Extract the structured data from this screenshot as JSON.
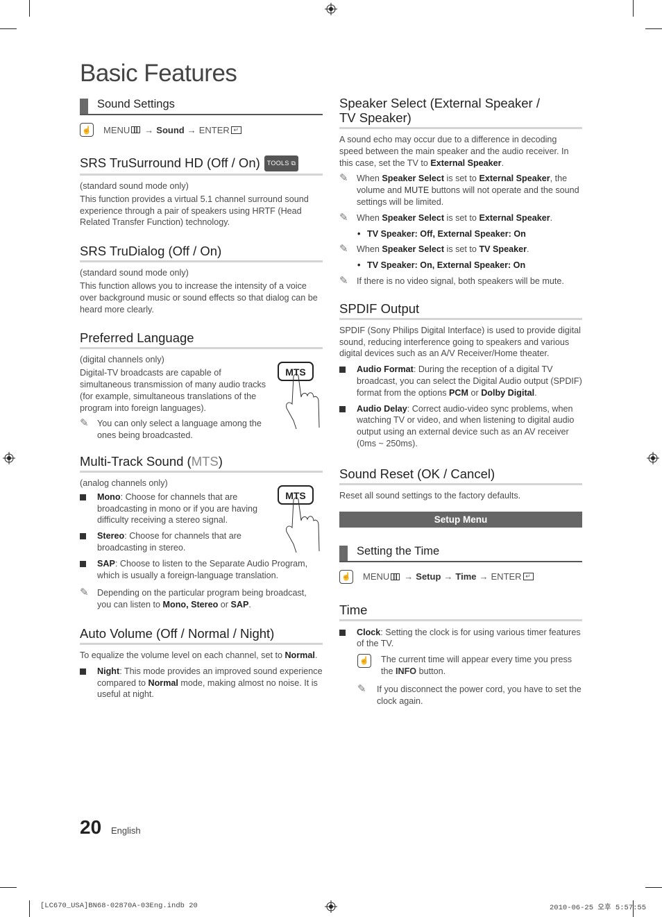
{
  "page": {
    "title": "Basic Features",
    "page_number": "20",
    "language": "English"
  },
  "slug": {
    "file": "[LC670_USA]BN68-02870A-03Eng.indb   20",
    "datetime": "2010-06-25   오후 5:57:55"
  },
  "left": {
    "sound_settings": {
      "header": "Sound Settings",
      "menu_path": {
        "menu": "MENU",
        "arrow": "→",
        "step1": "Sound",
        "enter": "ENTER"
      }
    },
    "srs_trusurround": {
      "title": "SRS TruSurround HD (Off / On)",
      "tools_badge": "TOOLS",
      "mode": "(standard sound mode only)",
      "body": "This function provides a virtual 5.1 channel surround sound experience through a pair of speakers using HRTF (Head Related Transfer Function) technology."
    },
    "srs_trudialog": {
      "title": "SRS TruDialog (Off / On)",
      "mode": "(standard sound mode only)",
      "body": "This function allows you to increase the intensity of a voice over background music or sound effects so that dialog can be heard more clearly."
    },
    "preferred_language": {
      "title": "Preferred Language",
      "mode": "(digital channels only)",
      "body": "Digital-TV broadcasts are capable of simultaneous transmission of many audio tracks (for example, simultaneous translations of the program into foreign languages).",
      "note": "You can only select a language among the ones being broadcasted.",
      "button_label": "MTS"
    },
    "multi_track": {
      "title_prefix": "Multi-Track Sound (",
      "title_mts": "MTS",
      "title_suffix": ")",
      "mode": "(analog channels only)",
      "button_label": "MTS",
      "items": [
        {
          "term": "Mono",
          "text": ": Choose for channels that are broadcasting in mono or if you are having difficulty receiving a stereo signal."
        },
        {
          "term": "Stereo",
          "text": ": Choose for channels that are broadcasting in stereo."
        },
        {
          "term": "SAP",
          "text": ": Choose to listen to the Separate Audio Program, which is usually a foreign-language translation."
        }
      ],
      "note_pre": "Depending on the particular program being broadcast, you can listen to ",
      "note_b1": "Mono, Stereo",
      "note_mid": " or ",
      "note_b2": "SAP",
      "note_end": "."
    },
    "auto_volume": {
      "title": "Auto Volume (Off / Normal / Night)",
      "body_pre": "To equalize the volume level on each channel, set to ",
      "body_b": "Normal",
      "body_end": ".",
      "item_term": "Night",
      "item_pre": ": This mode provides an improved sound experience compared to ",
      "item_b": "Normal",
      "item_end": " mode, making almost no noise. It is useful at night."
    }
  },
  "right": {
    "speaker_select": {
      "title_line1": "Speaker Select (External Speaker /",
      "title_line2": "TV Speaker)",
      "body_pre": "A sound echo may occur due to a difference in decoding speed between the main speaker and the audio receiver. In this case, set the TV to ",
      "body_b": "External Speaker",
      "body_end": ".",
      "note1": {
        "w": "When ",
        "b1": "Speaker Select",
        "m": " is set to ",
        "b2": "External Speaker",
        "e": ", the volume and ",
        "b3": "MUTE",
        "e2": " buttons will not operate and the sound settings will be limited."
      },
      "note2": {
        "w": "When ",
        "b1": "Speaker Select",
        "m": " is set to ",
        "b2": "External Speaker",
        "e": "."
      },
      "dot1": "TV Speaker: Off, External Speaker: On",
      "note3": {
        "w": "When ",
        "b1": "Speaker Select",
        "m": " is set to ",
        "b2": "TV Speaker",
        "e": "."
      },
      "dot2": "TV Speaker: On, External Speaker: On",
      "note4": "If there is no video signal, both speakers will be mute."
    },
    "spdif": {
      "title": "SPDIF Output",
      "body": "SPDIF (Sony Philips Digital Interface) is used to provide digital sound, reducing interference going to speakers and various digital devices such as an A/V Receiver/Home theater.",
      "item1_term": "Audio Format",
      "item1_pre": ": During the reception of a digital TV broadcast, you can select the Digital Audio output (SPDIF) format from the options ",
      "item1_b1": "PCM",
      "item1_mid": " or ",
      "item1_b2": "Dolby Digital",
      "item1_end": ".",
      "item2_term": "Audio Delay",
      "item2_text": ": Correct audio-video sync problems, when watching TV or video, and when listening to digital audio output using an external device such as an AV receiver (0ms ~ 250ms)."
    },
    "sound_reset": {
      "title": "Sound Reset (OK / Cancel)",
      "body": "Reset all sound settings to the factory defaults."
    },
    "setup_band": "Setup Menu",
    "setting_time": {
      "header": "Setting the Time",
      "menu_path": {
        "menu": "MENU",
        "arrow": "→",
        "step1": "Setup",
        "step2": "Time",
        "enter": "ENTER"
      }
    },
    "time": {
      "title": "Time",
      "item_term": "Clock",
      "item_text": ": Setting the clock is for using various timer features of the TV.",
      "tip_pre": "The current time will appear every time you press the ",
      "tip_b": "INFO",
      "tip_end": " button.",
      "note": "If you disconnect the power cord, you have to set the clock again."
    }
  }
}
